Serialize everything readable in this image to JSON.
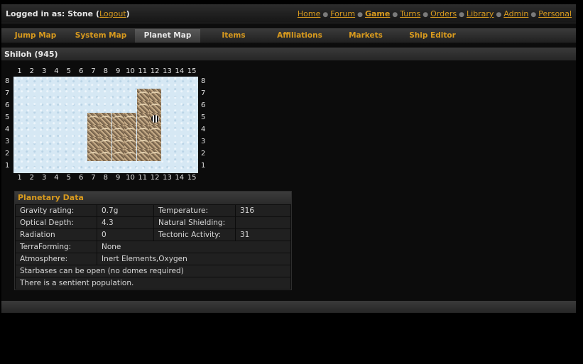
{
  "header": {
    "login_prefix": "Logged in as: Stone",
    "logout_label": "Logout",
    "links": [
      "Home",
      "Forum",
      "Game",
      "Turns",
      "Orders",
      "Library",
      "Admin",
      "Personal"
    ]
  },
  "tabs": [
    "Jump Map",
    "System Map",
    "Planet Map",
    "Items",
    "Affiliations",
    "Markets",
    "Ship Editor"
  ],
  "active_tab": "Planet Map",
  "page_title": "Shiloh (945)",
  "map": {
    "columns": [
      "1",
      "2",
      "3",
      "4",
      "5",
      "6",
      "7",
      "8",
      "9",
      "10",
      "11",
      "12",
      "13",
      "14",
      "15"
    ],
    "rows": [
      "8",
      "7",
      "6",
      "5",
      "4",
      "3",
      "2",
      "1"
    ]
  },
  "planetary_data": {
    "title": "Planetary Data",
    "rows": [
      [
        "Gravity rating:",
        "0.7g",
        "Temperature:",
        "316"
      ],
      [
        "Optical Depth:",
        "4.3",
        "Natural Shielding:",
        ""
      ],
      [
        "Radiation",
        "0",
        "Tectonic Activity:",
        "31"
      ]
    ],
    "terraforming_label": "TerraForming:",
    "terraforming_value": "None",
    "atmosphere_label": "Atmosphere:",
    "atmosphere_value": "Inert Elements,Oxygen",
    "starbase_note": "Starbases can be open (no domes required)",
    "sentient_note": "There is a sentient population."
  },
  "colors": {
    "accent": "#d89a1e",
    "ocean": "#d6e8f4",
    "land": "#8a7358"
  }
}
